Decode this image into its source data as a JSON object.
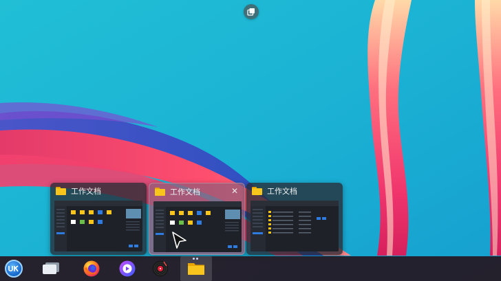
{
  "desktop": {
    "workspace_button_icon": "multitasking-view-icon"
  },
  "previews": [
    {
      "title": "工作文档",
      "icon": "folder-icon",
      "hovered": false
    },
    {
      "title": "工作文档",
      "icon": "folder-icon",
      "hovered": true,
      "close_glyph": "✕"
    },
    {
      "title": "工作文档",
      "icon": "folder-icon",
      "hovered": false
    }
  ],
  "taskbar": {
    "items": [
      {
        "name": "launcher",
        "icon": "deepin-launcher-icon"
      },
      {
        "name": "show-desktop",
        "icon": "multitask-windows-icon"
      },
      {
        "name": "firefox",
        "icon": "firefox-icon"
      },
      {
        "name": "music-player",
        "icon": "music-player-icon"
      },
      {
        "name": "media-player",
        "icon": "vinyl-record-icon"
      },
      {
        "name": "file-manager",
        "icon": "folder-icon",
        "active": true
      }
    ]
  },
  "colors": {
    "wallpaper_bg": "#1fb3d2",
    "taskbar_bg": "#261620",
    "folder_yellow": "#f8c51c",
    "accent_blue": "#2f7ce0"
  }
}
